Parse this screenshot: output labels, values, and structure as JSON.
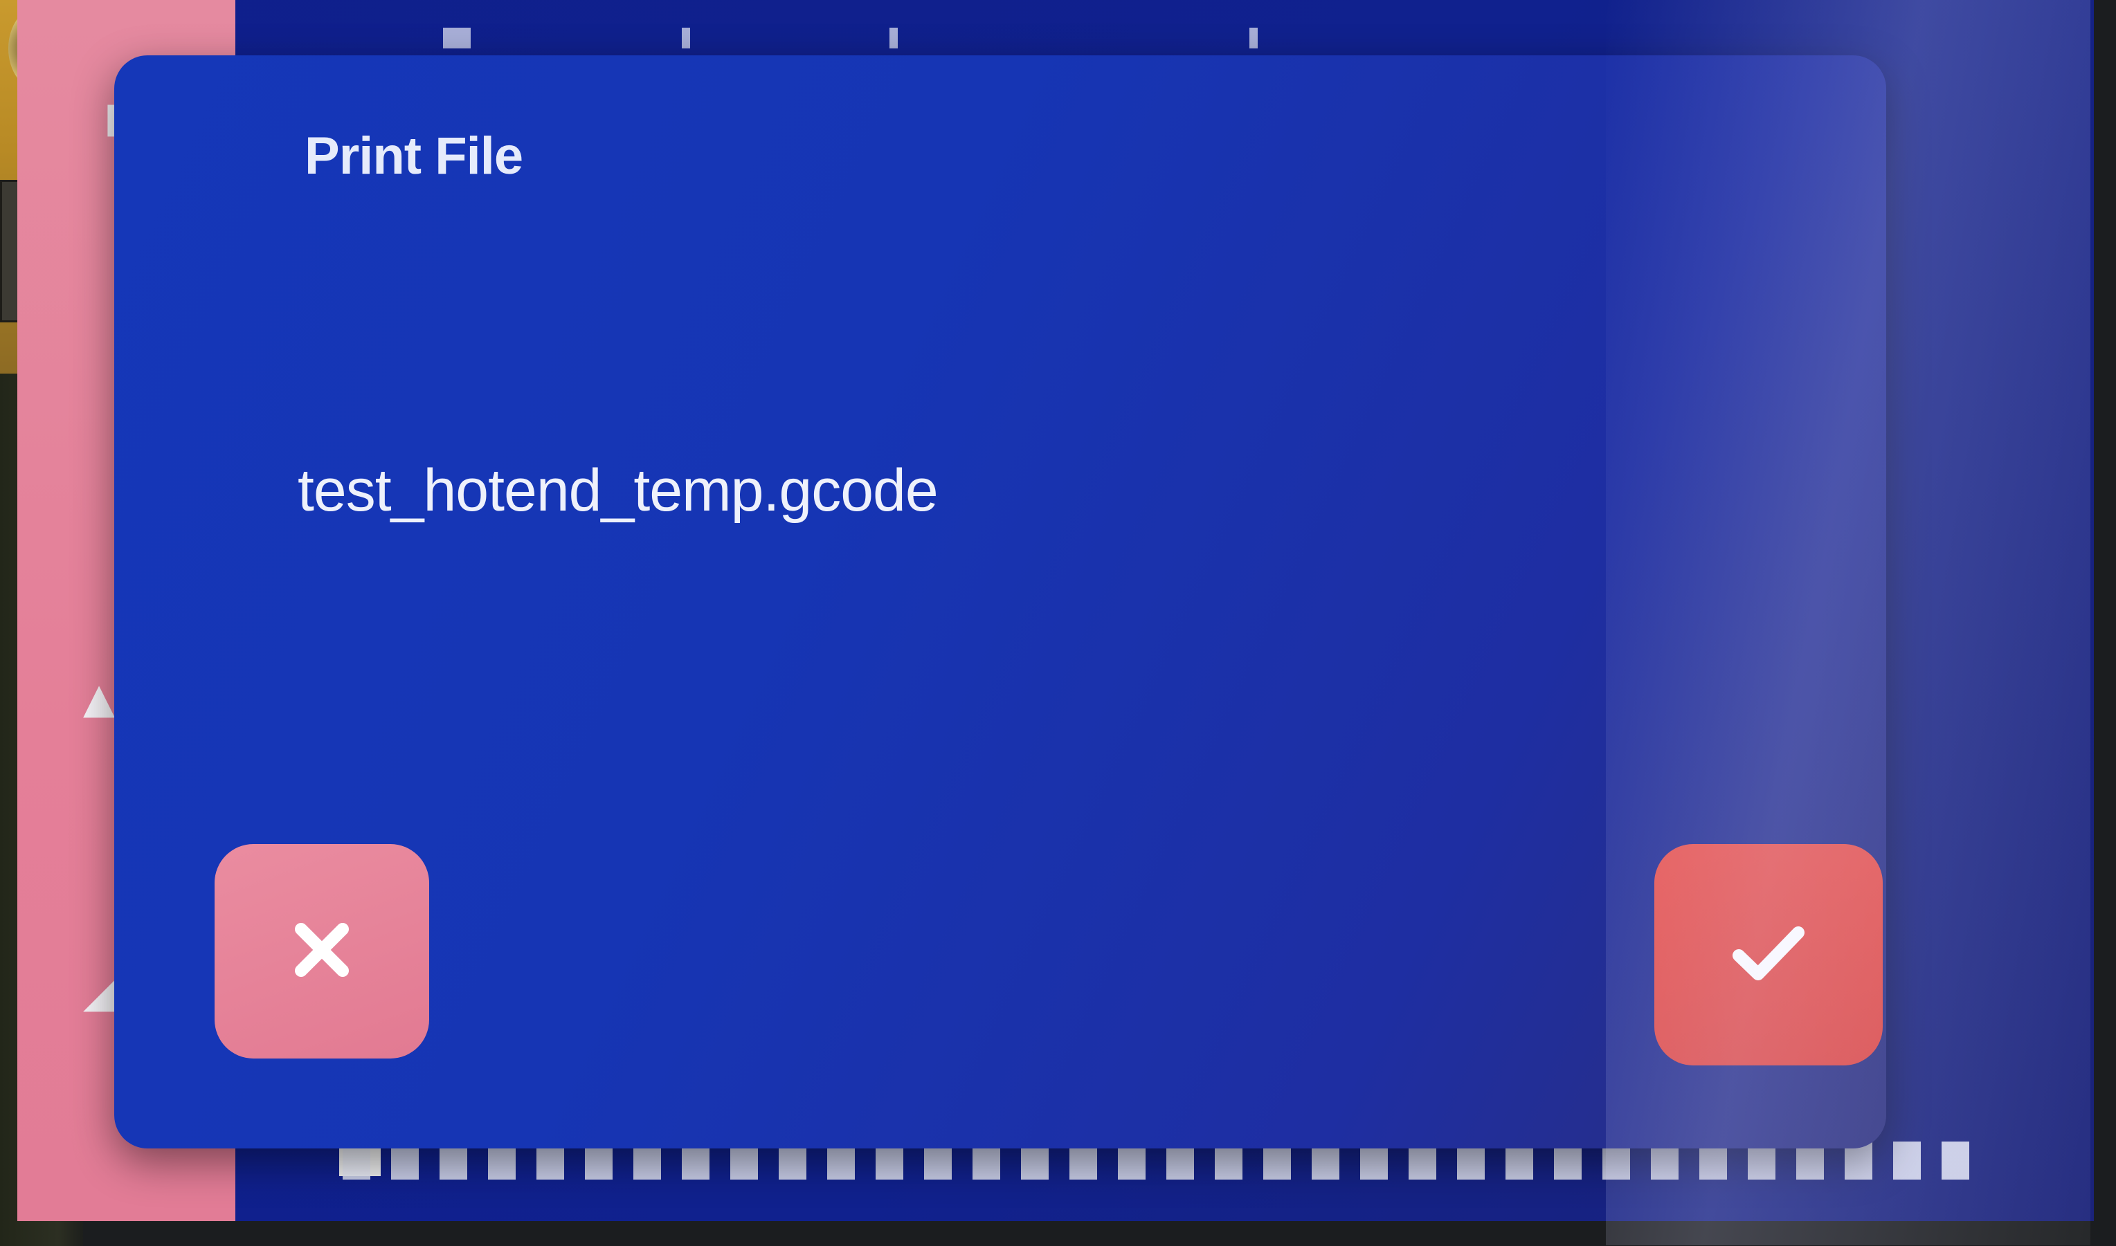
{
  "dialog": {
    "title": "Print File",
    "filename": "test_hotend_temp.gcode",
    "cancel_icon": "close-icon",
    "confirm_icon": "check-icon"
  },
  "colors": {
    "dialog_background": "#1635b4",
    "cancel_button": "#e27a92",
    "confirm_button": "#dc4744",
    "sidebar": "#e47f98",
    "text": "#eef1fb"
  }
}
